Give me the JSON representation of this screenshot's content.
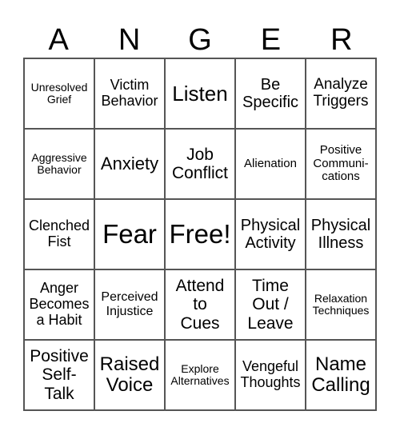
{
  "header": {
    "letters": [
      "A",
      "N",
      "G",
      "E",
      "R"
    ]
  },
  "cells": [
    "Unresolved\nGrief",
    "Victim\nBehavior",
    "Listen",
    "Be\nSpecific",
    "Analyze\nTriggers",
    "Aggressive\nBehavior",
    "Anxiety",
    "Job\nConflict",
    "Alienation",
    "Positive\nCommuni-\ncations",
    "Clenched\nFist",
    "Fear",
    "Free!",
    "Physical\nActivity",
    "Physical\nIllness",
    "Anger\nBecomes\na Habit",
    "Perceived\nInjustice",
    "Attend\nto\nCues",
    "Time\nOut /\nLeave",
    "Relaxation\nTechniques",
    "Positive\nSelf-\nTalk",
    "Raised\nVoice",
    "Explore\nAlternatives",
    "Vengeful\nThoughts",
    "Name\nCalling"
  ]
}
